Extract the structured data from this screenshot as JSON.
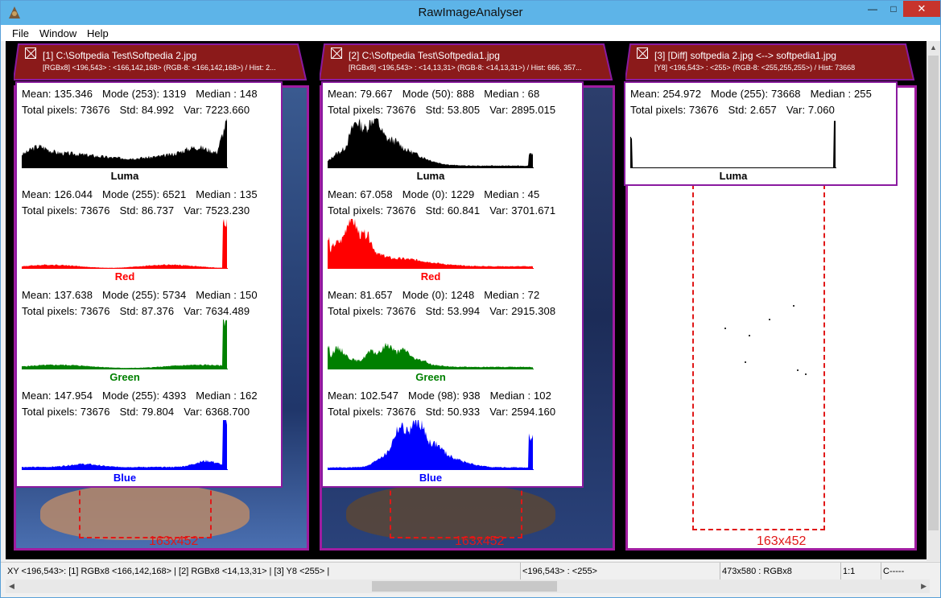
{
  "app": {
    "title": "RawImageAnalyser",
    "minimize": "—",
    "maximize": "□",
    "close": "✕"
  },
  "menu": [
    "File",
    "Window",
    "Help"
  ],
  "panels": [
    {
      "tab_title": "[1] C:\\Softpedia Test\\Softpedia 2.jpg",
      "tab_info": "[RGBx8] <196,543> : <166,142,168> (RGB-8: <166,142,168>) / Hist: 2...",
      "dims": "163x452",
      "channels": [
        {
          "mean": "Mean: 135.346",
          "mode": "Mode (253): 1319",
          "median": "Median : 148",
          "total": "Total pixels: 73676",
          "std": "Std: 84.992",
          "var": "Var: 7223.660",
          "label": "Luma",
          "color": "#000000"
        },
        {
          "mean": "Mean: 126.044",
          "mode": "Mode (255): 6521",
          "median": "Median : 135",
          "total": "Total pixels: 73676",
          "std": "Std: 86.737",
          "var": "Var: 7523.230",
          "label": "Red",
          "color": "#ff0000"
        },
        {
          "mean": "Mean: 137.638",
          "mode": "Mode (255): 5734",
          "median": "Median : 150",
          "total": "Total pixels: 73676",
          "std": "Std: 87.376",
          "var": "Var: 7634.489",
          "label": "Green",
          "color": "#008000"
        },
        {
          "mean": "Mean: 147.954",
          "mode": "Mode (255): 4393",
          "median": "Median : 162",
          "total": "Total pixels: 73676",
          "std": "Std: 79.804",
          "var": "Var: 6368.700",
          "label": "Blue",
          "color": "#0000ff"
        }
      ]
    },
    {
      "tab_title": "[2] C:\\Softpedia Test\\Softpedia1.jpg",
      "tab_info": "[RGBx8] <196,543> : <14,13,31> (RGB-8: <14,13,31>) / Hist: 666, 357...",
      "dims": "163x452",
      "channels": [
        {
          "mean": "Mean: 79.667",
          "mode": "Mode (50): 888",
          "median": "Median : 68",
          "total": "Total pixels: 73676",
          "std": "Std: 53.805",
          "var": "Var: 2895.015",
          "label": "Luma",
          "color": "#000000"
        },
        {
          "mean": "Mean: 67.058",
          "mode": "Mode (0): 1229",
          "median": "Median : 45",
          "total": "Total pixels: 73676",
          "std": "Std: 60.841",
          "var": "Var: 3701.671",
          "label": "Red",
          "color": "#ff0000"
        },
        {
          "mean": "Mean: 81.657",
          "mode": "Mode (0): 1248",
          "median": "Median : 72",
          "total": "Total pixels: 73676",
          "std": "Std: 53.994",
          "var": "Var: 2915.308",
          "label": "Green",
          "color": "#008000"
        },
        {
          "mean": "Mean: 102.547",
          "mode": "Mode (98): 938",
          "median": "Median : 102",
          "total": "Total pixels: 73676",
          "std": "Std: 50.933",
          "var": "Var: 2594.160",
          "label": "Blue",
          "color": "#0000ff"
        }
      ]
    },
    {
      "tab_title": "[3] [Diff] softpedia 2.jpg <--> softpedia1.jpg",
      "tab_info": "[Y8] <196,543> : <255> (RGB-8: <255,255,255>) / Hist: 73668",
      "dims": "163x452",
      "channels": [
        {
          "mean": "Mean: 254.972",
          "mode": "Mode (255): 73668",
          "median": "Median : 255",
          "total": "Total pixels: 73676",
          "std": "Std:  2.657",
          "var": "Var:  7.060",
          "label": "Luma",
          "color": "#000000"
        }
      ]
    }
  ],
  "status": {
    "xy": "XY <196,543>: [1] RGBx8 <166,142,168> | [2] RGBx8 <14,13,31> | [3] Y8 <255> |",
    "coord": "<196,543> : <255>",
    "size": "473x580 : RGBx8",
    "zoom": "1:1",
    "mode": "C-----"
  }
}
